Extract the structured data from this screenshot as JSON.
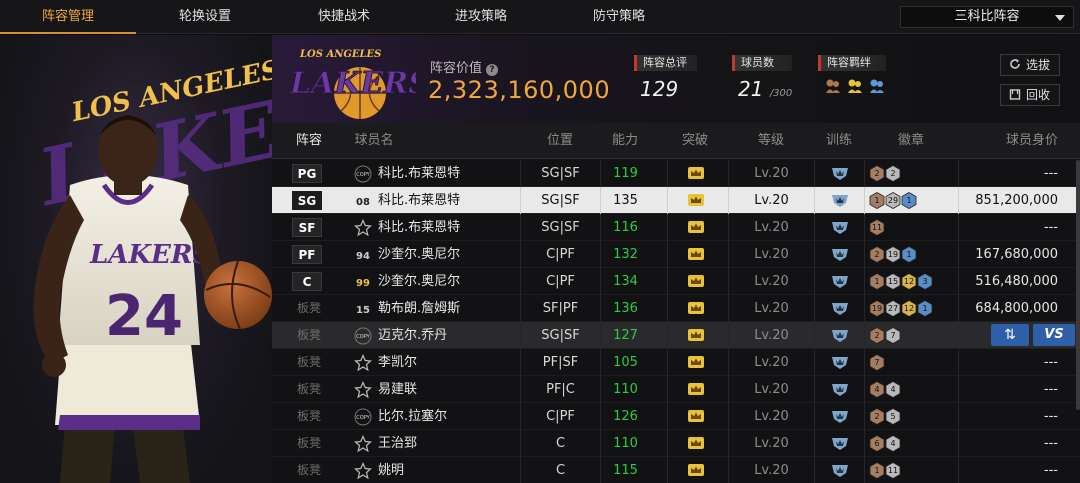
{
  "nav": {
    "tabs": [
      {
        "label": "阵容管理",
        "active": true
      },
      {
        "label": "轮换设置",
        "active": false
      },
      {
        "label": "快捷战术",
        "active": false
      },
      {
        "label": "进攻策略",
        "active": false
      },
      {
        "label": "防守策略",
        "active": false
      }
    ],
    "lineup_select": "三科比阵容"
  },
  "header": {
    "team_logo_text": "LAKERS",
    "team_logo_subtext": "LOS ANGELES",
    "value_label": "阵容价值",
    "value": "2,323,160,000",
    "stats": {
      "overall_label": "阵容总评",
      "overall_value": "129",
      "players_label": "球员数",
      "players_value": "21",
      "players_max": "/300",
      "bonds_label": "阵容羁绊"
    },
    "buttons": {
      "scout_label": "选拔",
      "recycle_label": "回收"
    }
  },
  "player_art": {
    "jersey_team": "LAKERS",
    "jersey_number": "24",
    "banner_text": "LAKERS",
    "banner_subtext": "LOS ANGELES"
  },
  "table": {
    "headers": [
      "阵容",
      "球员名",
      "位置",
      "能力",
      "突破",
      "等级",
      "训练",
      "徽章",
      "球员身价"
    ],
    "rows": [
      {
        "slot": "PG",
        "starter": true,
        "card": "COPY",
        "name": "科比.布莱恩特",
        "position": "SG|SF",
        "ability": "119",
        "level": "Lv.20",
        "badges": [
          {
            "n": "2",
            "c": "bronze"
          },
          {
            "n": "2",
            "c": "silver"
          }
        ],
        "value": "---"
      },
      {
        "slot": "SG",
        "starter": true,
        "selected": true,
        "card": "08",
        "name": "科比.布莱恩特",
        "position": "SG|SF",
        "ability": "135",
        "level": "Lv.20",
        "badges": [
          {
            "n": "1",
            "c": "bronze"
          },
          {
            "n": "29",
            "c": "silver"
          },
          {
            "n": "1",
            "c": "blue"
          }
        ],
        "value": "851,200,000"
      },
      {
        "slot": "SF",
        "starter": true,
        "card": "STAR",
        "name": "科比.布莱恩特",
        "position": "SG|SF",
        "ability": "116",
        "level": "Lv.20",
        "badges": [
          {
            "n": "11",
            "c": "bronze"
          }
        ],
        "value": "---"
      },
      {
        "slot": "PF",
        "starter": true,
        "card": "94",
        "name": "沙奎尔.奥尼尔",
        "position": "C|PF",
        "ability": "132",
        "level": "Lv.20",
        "badges": [
          {
            "n": "2",
            "c": "bronze"
          },
          {
            "n": "19",
            "c": "silver"
          },
          {
            "n": "1",
            "c": "blue"
          }
        ],
        "value": "167,680,000"
      },
      {
        "slot": "C",
        "starter": true,
        "card": "99",
        "name": "沙奎尔.奥尼尔",
        "position": "C|PF",
        "ability": "134",
        "level": "Lv.20",
        "badges": [
          {
            "n": "1",
            "c": "bronze"
          },
          {
            "n": "15",
            "c": "silver"
          },
          {
            "n": "12",
            "c": "gold"
          },
          {
            "n": "3",
            "c": "blue"
          }
        ],
        "value": "516,480,000"
      },
      {
        "slot": "板凳",
        "starter": false,
        "card": "15",
        "name": "勒布朗.詹姆斯",
        "position": "SF|PF",
        "ability": "136",
        "level": "Lv.20",
        "badges": [
          {
            "n": "19",
            "c": "bronze"
          },
          {
            "n": "27",
            "c": "silver"
          },
          {
            "n": "12",
            "c": "gold"
          },
          {
            "n": "1",
            "c": "blue"
          }
        ],
        "value": "684,800,000"
      },
      {
        "slot": "板凳",
        "starter": false,
        "highlight": true,
        "card": "COPY",
        "name": "迈克尔.乔丹",
        "position": "SG|SF",
        "ability": "127",
        "level": "Lv.20",
        "badges": [
          {
            "n": "2",
            "c": "bronze"
          },
          {
            "n": "7",
            "c": "silver"
          }
        ],
        "value": "",
        "actions": {
          "swap": "⇅",
          "vs": "VS"
        }
      },
      {
        "slot": "板凳",
        "starter": false,
        "card": "STAR",
        "name": "李凯尔",
        "position": "PF|SF",
        "ability": "105",
        "level": "Lv.20",
        "badges": [
          {
            "n": "7",
            "c": "bronze"
          }
        ],
        "value": "---"
      },
      {
        "slot": "板凳",
        "starter": false,
        "card": "STAR",
        "name": "易建联",
        "position": "PF|C",
        "ability": "110",
        "level": "Lv.20",
        "badges": [
          {
            "n": "4",
            "c": "bronze"
          },
          {
            "n": "4",
            "c": "silver"
          }
        ],
        "value": "---"
      },
      {
        "slot": "板凳",
        "starter": false,
        "card": "COPY",
        "name": "比尔.拉塞尔",
        "position": "C|PF",
        "ability": "126",
        "level": "Lv.20",
        "badges": [
          {
            "n": "2",
            "c": "bronze"
          },
          {
            "n": "5",
            "c": "silver"
          }
        ],
        "value": "---"
      },
      {
        "slot": "板凳",
        "starter": false,
        "card": "STAR",
        "name": "王治郅",
        "position": "C",
        "ability": "110",
        "level": "Lv.20",
        "badges": [
          {
            "n": "6",
            "c": "bronze"
          },
          {
            "n": "4",
            "c": "silver"
          }
        ],
        "value": "---"
      },
      {
        "slot": "板凳",
        "starter": false,
        "card": "STAR",
        "name": "姚明",
        "position": "C",
        "ability": "115",
        "level": "Lv.20",
        "badges": [
          {
            "n": "1",
            "c": "bronze"
          },
          {
            "n": "11",
            "c": "silver"
          }
        ],
        "value": "---"
      }
    ]
  },
  "colors": {
    "accent": "#f0a640",
    "ability_green": "#2ecc40",
    "crown_gold": "#e8c23a",
    "shield_blue": "#7fa6c9",
    "badge_bronze": "#a47d63",
    "badge_silver": "#b9b9b9",
    "badge_gold": "#d6b44a",
    "badge_blue": "#5a8cc8",
    "action_blue": "#2f5fa8"
  }
}
